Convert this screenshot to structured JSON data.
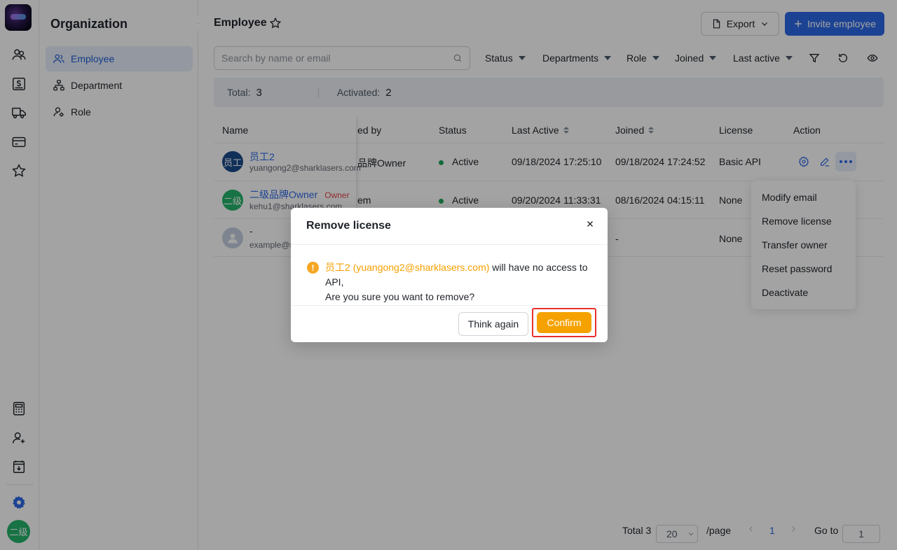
{
  "sidebar": {
    "title": "Organization",
    "collapse_glyph": "◀",
    "items": [
      {
        "label": "Employee",
        "icon": "users-icon",
        "active": true
      },
      {
        "label": "Department",
        "icon": "hierarchy-icon",
        "active": false
      },
      {
        "label": "Role",
        "icon": "role-icon",
        "active": false
      }
    ]
  },
  "rail": {
    "avatar_text": "二级",
    "icons": [
      "people-icon",
      "billing-icon",
      "delivery-truck-icon",
      "wallet-icon",
      "star-icon",
      "calculator-icon",
      "user-add-icon",
      "download-box-icon",
      "settings-icon"
    ]
  },
  "header": {
    "title": "Employee",
    "export_label": "Export",
    "invite_label": "Invite employee"
  },
  "toolbar": {
    "search_placeholder": "Search by name or email",
    "filters": [
      "Status",
      "Departments",
      "Role",
      "Joined",
      "Last active"
    ]
  },
  "summary": {
    "total_label": "Total:",
    "total_value": "3",
    "activated_label": "Activated:",
    "activated_value": "2"
  },
  "table": {
    "columns": [
      "Name",
      "ed by",
      "Status",
      "Last Active",
      "Joined",
      "License",
      "Action"
    ],
    "rows": [
      {
        "avatar": "员工",
        "avatar_color": "#1b4c8c",
        "name": "员工2",
        "email": "yuangong2@sharklasers.com",
        "invited_by": "品牌Owner",
        "status": "Active",
        "last_active": "09/18/2024 17:25:10",
        "joined": "09/18/2024 17:24:52",
        "license": "Basic API"
      },
      {
        "avatar": "二级",
        "avatar_color": "#24b36b",
        "name": "二级品牌Owner",
        "tag": "Owner",
        "email": "kehu1@sharklasers.com",
        "invited_by": "em",
        "status": "Active",
        "last_active": "09/20/2024 11:33:31",
        "joined": "08/16/2024 04:15:11",
        "license": "None"
      },
      {
        "avatar": "",
        "avatar_color": "#c5cfe0",
        "name": "-",
        "email": "example@s",
        "invited_by": "",
        "status": "",
        "last_active": "",
        "joined": "-",
        "license": "None"
      }
    ]
  },
  "action_menu": {
    "items": [
      "Modify email",
      "Remove license",
      "Transfer owner",
      "Reset password",
      "Deactivate"
    ]
  },
  "pagination": {
    "total_text": "Total 3",
    "page_size": "20",
    "per_page": "/page",
    "current_page": "1",
    "goto_label": "Go to",
    "goto_value": "1"
  },
  "dialog": {
    "title": "Remove license",
    "highlight": "员工2 (yuangong2@sharklasers.com)",
    "message_rest": " will have no access to API,",
    "message_line2": "Are you sure you want to remove?",
    "cancel_label": "Think again",
    "confirm_label": "Confirm",
    "warning_glyph": "!"
  },
  "colors": {
    "primary": "#2c6ae6",
    "confirm": "#f5a200",
    "highlight_box": "#e5312f",
    "status_active": "#1fa65a"
  }
}
